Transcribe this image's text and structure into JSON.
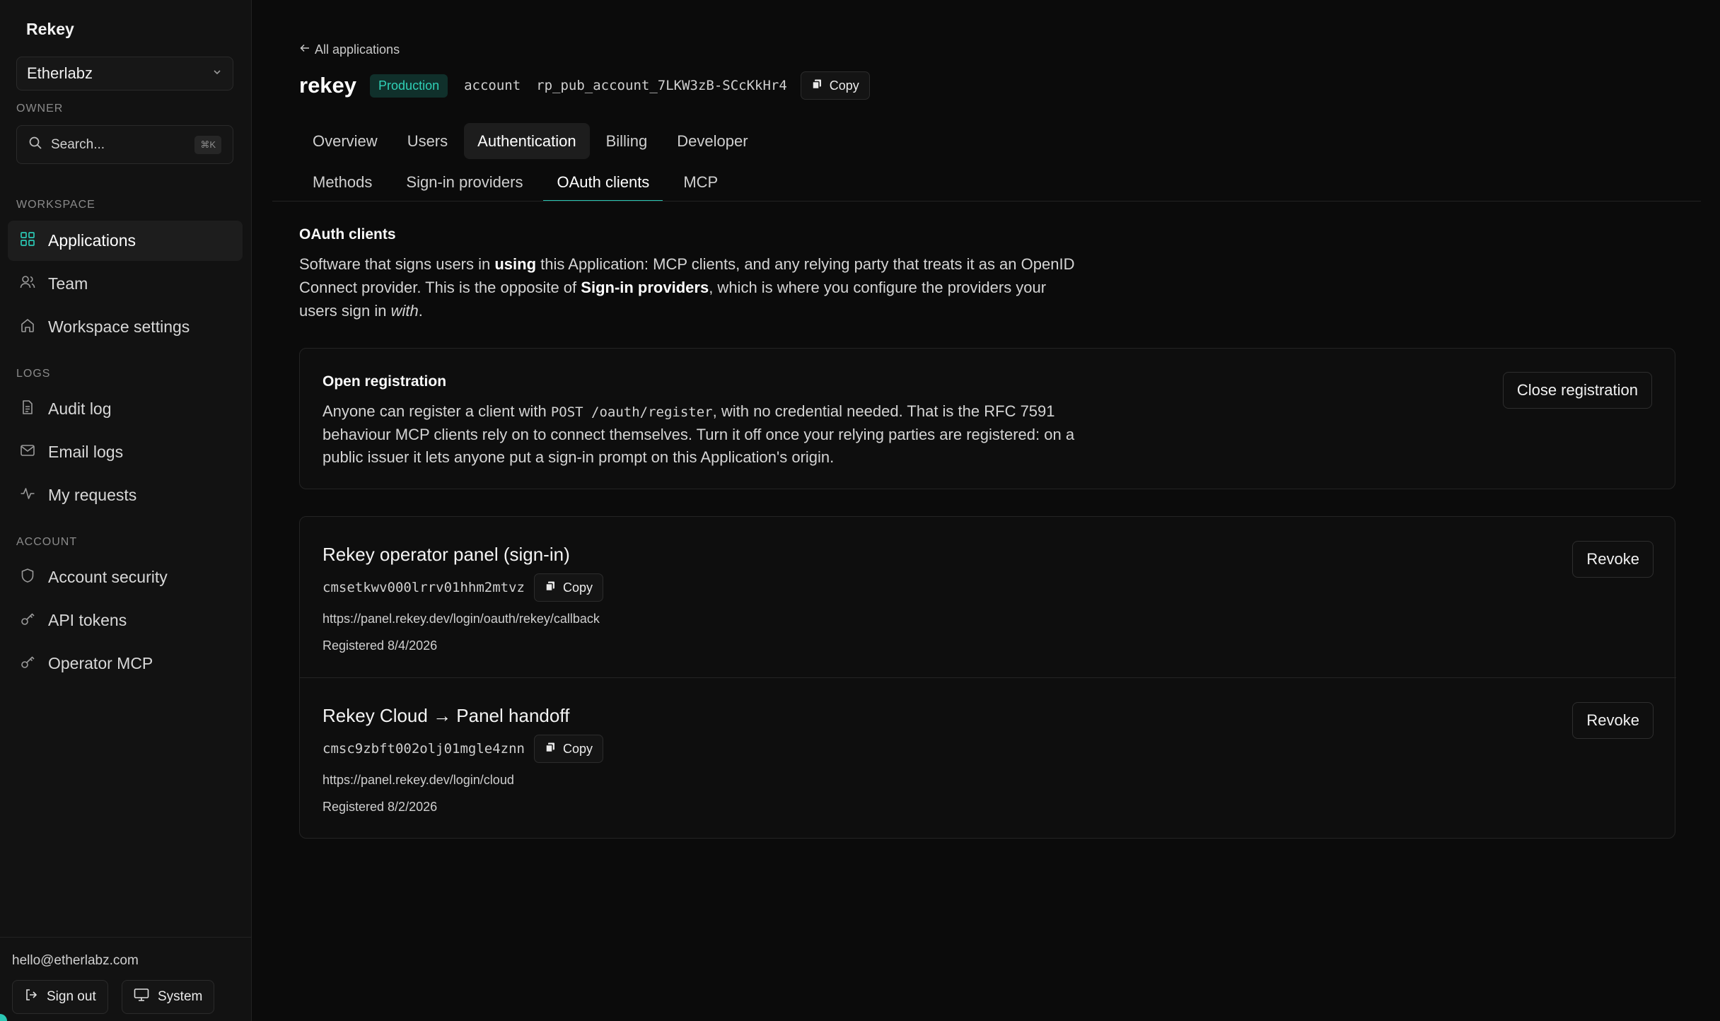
{
  "sidebar": {
    "brand": "Rekey",
    "workspace_name": "Etherlabz",
    "owner_label": "OWNER",
    "search_placeholder": "Search...",
    "search_shortcut": "⌘K",
    "workspace_label": "WORKSPACE",
    "logs_label": "LOGS",
    "account_label": "ACCOUNT",
    "items": [
      {
        "label": "Applications",
        "icon": "grid-icon",
        "active": true
      },
      {
        "label": "Team",
        "icon": "users-icon"
      },
      {
        "label": "Workspace settings",
        "icon": "home-icon"
      },
      {
        "label": "Audit log",
        "icon": "document-icon"
      },
      {
        "label": "Email logs",
        "icon": "mail-icon"
      },
      {
        "label": "My requests",
        "icon": "activity-icon"
      },
      {
        "label": "Account security",
        "icon": "shield-icon"
      },
      {
        "label": "API tokens",
        "icon": "key-icon"
      },
      {
        "label": "Operator MCP",
        "icon": "key-icon"
      }
    ],
    "footer": {
      "email": "hello@etherlabz.com",
      "sign_out": "Sign out",
      "theme": "System"
    }
  },
  "header": {
    "back_label": "All applications",
    "app_name": "rekey",
    "environment": "Production",
    "key_kind": "account",
    "public_key": "rp_pub_account_7LKW3zB-SCcKkHr4",
    "copy_label": "Copy"
  },
  "tabs": [
    "Overview",
    "Users",
    "Authentication",
    "Billing",
    "Developer"
  ],
  "active_tab": "Authentication",
  "subtabs": [
    "Methods",
    "Sign-in providers",
    "OAuth clients",
    "MCP"
  ],
  "active_subtab": "OAuth clients",
  "section": {
    "title": "OAuth clients",
    "desc_1": "Software that signs users in ",
    "desc_b1": "using",
    "desc_2": " this Application: MCP clients, and any relying party that treats it as an OpenID Connect provider. This is the opposite of ",
    "desc_b2": "Sign-in providers",
    "desc_3": ", which is where you configure the providers your users sign in ",
    "desc_i": "with",
    "desc_4": "."
  },
  "registration": {
    "title": "Open registration",
    "desc_1": "Anyone can register a client with ",
    "code": "POST /oauth/register",
    "desc_2": ", with no credential needed. That is the RFC 7591 behaviour MCP clients rely on to connect themselves. Turn it off once your relying parties are registered: on a public issuer it lets anyone put a sign-in prompt on this Application's origin.",
    "button": "Close registration"
  },
  "clients": [
    {
      "name": "Rekey operator panel (sign-in)",
      "id": "cmsetkwv000lrrv01hhm2mtvz",
      "url": "https://panel.rekey.dev/login/oauth/rekey/callback",
      "registered": "Registered 8/4/2026",
      "revoke": "Revoke"
    },
    {
      "name": "Rekey Cloud → Panel handoff",
      "id": "cmsc9zbft002olj01mgle4znn",
      "url": "https://panel.rekey.dev/login/cloud",
      "registered": "Registered 8/2/2026",
      "revoke": "Revoke"
    }
  ],
  "colors": {
    "accent": "#2bc7b4",
    "background": "#0b0b0b",
    "sidebar": "#121212"
  }
}
